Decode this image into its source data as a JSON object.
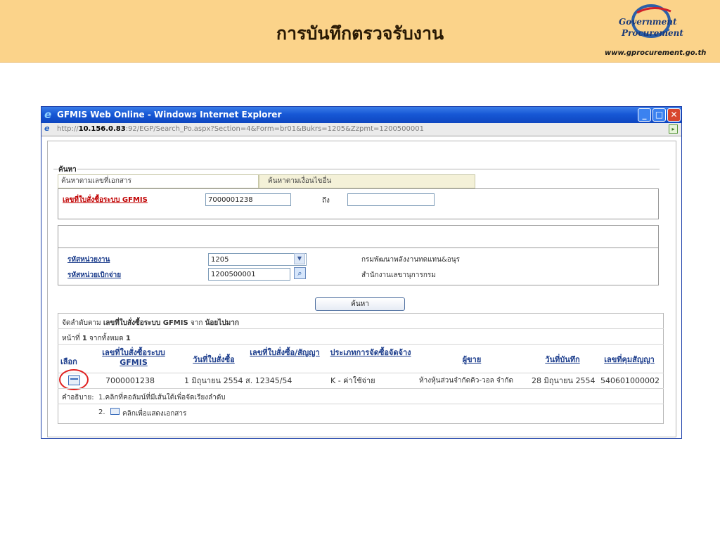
{
  "slide": {
    "title": "การบันทึกตรวจรับงาน",
    "logo_line1": "Government",
    "logo_line2": "Procurement",
    "logo_url": "www.gprocurement.go.th"
  },
  "window": {
    "title": "GFMIS Web Online - Windows Internet Explorer",
    "address_prefix": "http://",
    "address_host": "10.156.0.83",
    "address_rest": ":92/EGP/Search_Po.aspx?Section=4&Form=br01&Bukrs=1205&Zzpmt=1200500001"
  },
  "search": {
    "legend": "ค้นหา",
    "tab_doc": "ค้นหาตามเลขที่เอกสาร",
    "tab_other": "ค้นหาตามเงื่อนไขอื่น",
    "po_label": "เลขที่ใบสั่งซื้อระบบ GFMIS",
    "po_from": "7000001238",
    "to_label": "ถึง",
    "po_to": "",
    "unit_label": "รหัสหน่วยงาน",
    "unit_value": "1205",
    "unit_name": "กรมพัฒนาพลังงานทดแทน&อนุร",
    "disb_label": "รหัสหน่วยเบิกจ่าย",
    "disb_value": "1200500001",
    "disb_name": "สำนักงานเลขานุการกรม",
    "search_button": "ค้นหา"
  },
  "results": {
    "sort_prefix": "จัดลำดับตาม",
    "sort_field": "เลขที่ใบสั่งซื้อระบบ GFMIS",
    "sort_from": "จาก",
    "sort_order": "น้อยไปมาก",
    "page_prefix": "หน้าที่",
    "page_no": "1",
    "page_mid": "จากทั้งหมด",
    "page_total": "1",
    "columns": {
      "select": "เลือก",
      "po_no": "เลขที่ใบสั่งซื้อระบบ GFMIS",
      "po_date": "วันที่ใบสั่งซื้อ",
      "contract_no": "เลขที่ใบสั่งซื้อ/สัญญา",
      "proc_type": "ประเภทการจัดซื้อจัดจ้าง",
      "vendor": "ผู้ขาย",
      "record_date": "วันที่บันทึก",
      "control_no": "เลขที่คุมสัญญา"
    },
    "rows": [
      {
        "po_no": "7000001238",
        "po_date": "1 มิถุนายน 2554",
        "contract_no": "ส. 12345/54",
        "proc_type": "K - ค่าใช้จ่าย",
        "vendor": "ห้างหุ้นส่วนจำกัดคิว-วอล จำกัด",
        "record_date": "28 มิถุนายน 2554",
        "control_no": "540601000002"
      }
    ],
    "note_label": "คำอธิบาย:",
    "note1": "1.คลิกที่คอลัมน์ที่มีเส้นใต้เพื่อจัดเรียงลำดับ",
    "note2_prefix": "2.",
    "note2": "คลิกเพื่อแสดงเอกสาร"
  },
  "colors": {
    "banner": "#fbd38a",
    "titlebar": "#1758d6",
    "link_red": "#c00000",
    "link_blue": "#1c3d8c",
    "highlight": "#e02020"
  },
  "icons": [
    "ie-icon",
    "minimize-icon",
    "maximize-icon",
    "close-icon",
    "go-icon",
    "dropdown-arrow-icon",
    "magnifier-icon",
    "document-icon"
  ]
}
